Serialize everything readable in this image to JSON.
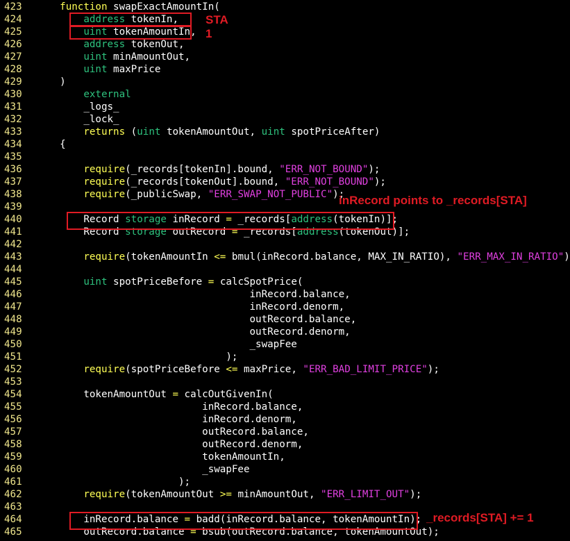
{
  "colors": {
    "background": "#000000",
    "line_number": "#f0e68c",
    "plain": "#ffffff",
    "keyword": "#ffff55",
    "type": "#2ec27e",
    "string": "#e040e0",
    "annotation": "#e01b24"
  },
  "lines": [
    {
      "n": "423",
      "tokens": [
        [
          "plain",
          "    "
        ],
        [
          "kw",
          "function"
        ],
        [
          "plain",
          " swapExactAmountIn("
        ]
      ]
    },
    {
      "n": "424",
      "tokens": [
        [
          "plain",
          "        "
        ],
        [
          "type",
          "address"
        ],
        [
          "plain",
          " tokenIn,"
        ]
      ]
    },
    {
      "n": "425",
      "tokens": [
        [
          "plain",
          "        "
        ],
        [
          "type",
          "uint"
        ],
        [
          "plain",
          " tokenAmountIn,"
        ]
      ]
    },
    {
      "n": "426",
      "tokens": [
        [
          "plain",
          "        "
        ],
        [
          "type",
          "address"
        ],
        [
          "plain",
          " tokenOut,"
        ]
      ]
    },
    {
      "n": "427",
      "tokens": [
        [
          "plain",
          "        "
        ],
        [
          "type",
          "uint"
        ],
        [
          "plain",
          " minAmountOut,"
        ]
      ]
    },
    {
      "n": "428",
      "tokens": [
        [
          "plain",
          "        "
        ],
        [
          "type",
          "uint"
        ],
        [
          "plain",
          " maxPrice"
        ]
      ]
    },
    {
      "n": "429",
      "tokens": [
        [
          "plain",
          "    )"
        ]
      ]
    },
    {
      "n": "430",
      "tokens": [
        [
          "plain",
          "        "
        ],
        [
          "type",
          "external"
        ]
      ]
    },
    {
      "n": "431",
      "tokens": [
        [
          "plain",
          "        _logs_"
        ]
      ]
    },
    {
      "n": "432",
      "tokens": [
        [
          "plain",
          "        _lock_"
        ]
      ]
    },
    {
      "n": "433",
      "tokens": [
        [
          "plain",
          "        "
        ],
        [
          "kw",
          "returns"
        ],
        [
          "plain",
          " ("
        ],
        [
          "type",
          "uint"
        ],
        [
          "plain",
          " tokenAmountOut, "
        ],
        [
          "type",
          "uint"
        ],
        [
          "plain",
          " spotPriceAfter)"
        ]
      ]
    },
    {
      "n": "434",
      "tokens": [
        [
          "plain",
          "    {"
        ]
      ]
    },
    {
      "n": "435",
      "tokens": []
    },
    {
      "n": "436",
      "tokens": [
        [
          "plain",
          "        "
        ],
        [
          "kw",
          "require"
        ],
        [
          "plain",
          "(_records[tokenIn].bound, "
        ],
        [
          "str",
          "\"ERR_NOT_BOUND\""
        ],
        [
          "plain",
          ");"
        ]
      ]
    },
    {
      "n": "437",
      "tokens": [
        [
          "plain",
          "        "
        ],
        [
          "kw",
          "require"
        ],
        [
          "plain",
          "(_records[tokenOut].bound, "
        ],
        [
          "str",
          "\"ERR_NOT_BOUND\""
        ],
        [
          "plain",
          ");"
        ]
      ]
    },
    {
      "n": "438",
      "tokens": [
        [
          "plain",
          "        "
        ],
        [
          "kw",
          "require"
        ],
        [
          "plain",
          "(_publicSwap, "
        ],
        [
          "str",
          "\"ERR_SWAP_NOT_PUBLIC\""
        ],
        [
          "plain",
          ");"
        ]
      ]
    },
    {
      "n": "439",
      "tokens": []
    },
    {
      "n": "440",
      "tokens": [
        [
          "plain",
          "        Record "
        ],
        [
          "type",
          "storage"
        ],
        [
          "plain",
          " inRecord "
        ],
        [
          "op",
          "="
        ],
        [
          "plain",
          " _records["
        ],
        [
          "type",
          "address"
        ],
        [
          "plain",
          "(tokenIn)];"
        ]
      ]
    },
    {
      "n": "441",
      "tokens": [
        [
          "plain",
          "        Record "
        ],
        [
          "type",
          "storage"
        ],
        [
          "plain",
          " outRecord "
        ],
        [
          "op",
          "="
        ],
        [
          "plain",
          " _records["
        ],
        [
          "type",
          "address"
        ],
        [
          "plain",
          "(tokenOut)];"
        ]
      ]
    },
    {
      "n": "442",
      "tokens": []
    },
    {
      "n": "443",
      "tokens": [
        [
          "plain",
          "        "
        ],
        [
          "kw",
          "require"
        ],
        [
          "plain",
          "(tokenAmountIn "
        ],
        [
          "op",
          "<="
        ],
        [
          "plain",
          " bmul(inRecord.balance, MAX_IN_RATIO), "
        ],
        [
          "str",
          "\"ERR_MAX_IN_RATIO\""
        ],
        [
          "plain",
          ");"
        ]
      ]
    },
    {
      "n": "444",
      "tokens": []
    },
    {
      "n": "445",
      "tokens": [
        [
          "plain",
          "        "
        ],
        [
          "type",
          "uint"
        ],
        [
          "plain",
          " spotPriceBefore "
        ],
        [
          "op",
          "="
        ],
        [
          "plain",
          " calcSpotPrice("
        ]
      ]
    },
    {
      "n": "446",
      "tokens": [
        [
          "plain",
          "                                    inRecord.balance,"
        ]
      ]
    },
    {
      "n": "447",
      "tokens": [
        [
          "plain",
          "                                    inRecord.denorm,"
        ]
      ]
    },
    {
      "n": "448",
      "tokens": [
        [
          "plain",
          "                                    outRecord.balance,"
        ]
      ]
    },
    {
      "n": "449",
      "tokens": [
        [
          "plain",
          "                                    outRecord.denorm,"
        ]
      ]
    },
    {
      "n": "450",
      "tokens": [
        [
          "plain",
          "                                    _swapFee"
        ]
      ]
    },
    {
      "n": "451",
      "tokens": [
        [
          "plain",
          "                                );"
        ]
      ]
    },
    {
      "n": "452",
      "tokens": [
        [
          "plain",
          "        "
        ],
        [
          "kw",
          "require"
        ],
        [
          "plain",
          "(spotPriceBefore "
        ],
        [
          "op",
          "<="
        ],
        [
          "plain",
          " maxPrice, "
        ],
        [
          "str",
          "\"ERR_BAD_LIMIT_PRICE\""
        ],
        [
          "plain",
          ");"
        ]
      ]
    },
    {
      "n": "453",
      "tokens": []
    },
    {
      "n": "454",
      "tokens": [
        [
          "plain",
          "        tokenAmountOut "
        ],
        [
          "op",
          "="
        ],
        [
          "plain",
          " calcOutGivenIn("
        ]
      ]
    },
    {
      "n": "455",
      "tokens": [
        [
          "plain",
          "                            inRecord.balance,"
        ]
      ]
    },
    {
      "n": "456",
      "tokens": [
        [
          "plain",
          "                            inRecord.denorm,"
        ]
      ]
    },
    {
      "n": "457",
      "tokens": [
        [
          "plain",
          "                            outRecord.balance,"
        ]
      ]
    },
    {
      "n": "458",
      "tokens": [
        [
          "plain",
          "                            outRecord.denorm,"
        ]
      ]
    },
    {
      "n": "459",
      "tokens": [
        [
          "plain",
          "                            tokenAmountIn,"
        ]
      ]
    },
    {
      "n": "460",
      "tokens": [
        [
          "plain",
          "                            _swapFee"
        ]
      ]
    },
    {
      "n": "461",
      "tokens": [
        [
          "plain",
          "                        );"
        ]
      ]
    },
    {
      "n": "462",
      "tokens": [
        [
          "plain",
          "        "
        ],
        [
          "kw",
          "require"
        ],
        [
          "plain",
          "(tokenAmountOut "
        ],
        [
          "op",
          ">="
        ],
        [
          "plain",
          " minAmountOut, "
        ],
        [
          "str",
          "\"ERR_LIMIT_OUT\""
        ],
        [
          "plain",
          ");"
        ]
      ]
    },
    {
      "n": "463",
      "tokens": []
    },
    {
      "n": "464",
      "tokens": [
        [
          "plain",
          "        inRecord.balance "
        ],
        [
          "op",
          "="
        ],
        [
          "plain",
          " badd(inRecord.balance, tokenAmountIn);"
        ]
      ]
    },
    {
      "n": "465",
      "tokens": [
        [
          "plain",
          "        outRecord.balance "
        ],
        [
          "op",
          "="
        ],
        [
          "plain",
          " bsub(outRecord.balance, tokenAmountOut);"
        ]
      ]
    }
  ],
  "annotations": {
    "sta": "STA",
    "one": "1",
    "points_to": "inRecord points to _records[STA]",
    "increment": "_records[STA] += 1"
  }
}
